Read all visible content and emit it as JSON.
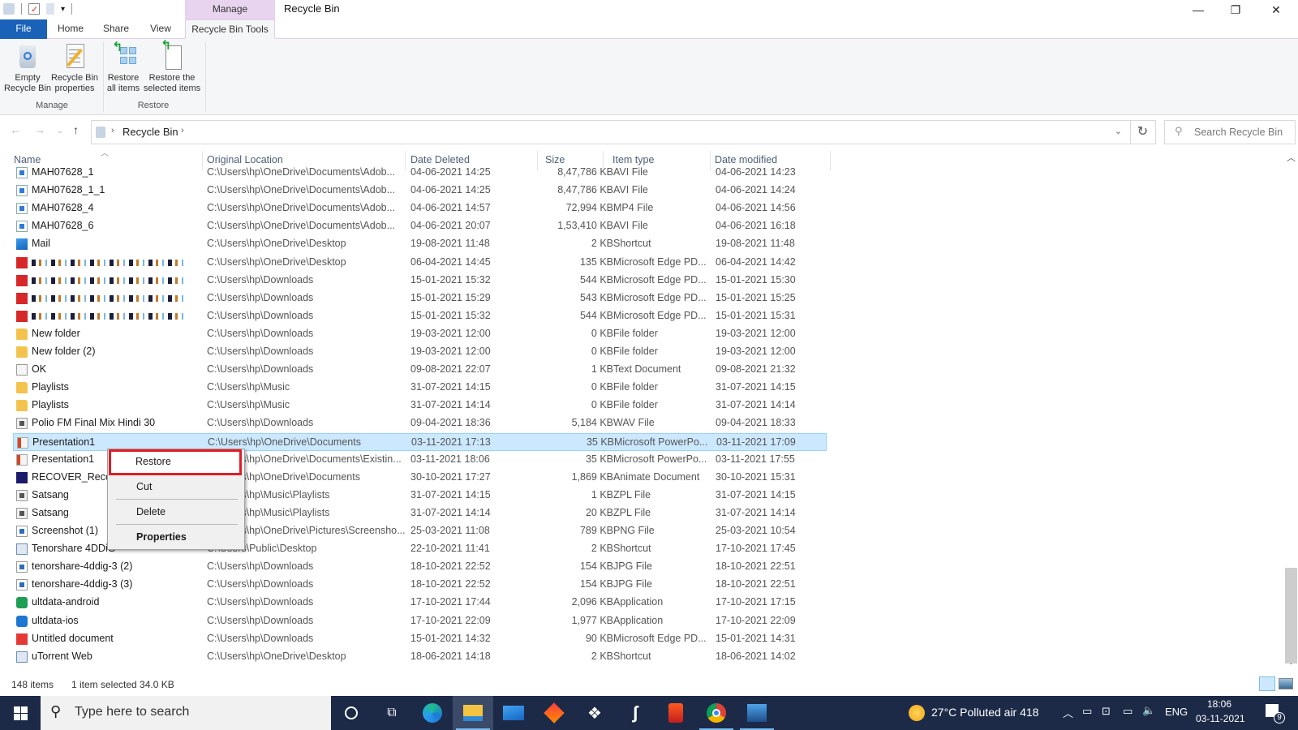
{
  "window": {
    "title": "Recycle Bin",
    "contextual_tab_group": "Manage",
    "controls": [
      "minimize",
      "maximize",
      "close"
    ]
  },
  "ribbon": {
    "tabs": [
      {
        "label": "File"
      },
      {
        "label": "Home"
      },
      {
        "label": "Share"
      },
      {
        "label": "View"
      },
      {
        "label": "Recycle Bin Tools"
      }
    ],
    "active_tab": "Recycle Bin Tools",
    "groups": [
      {
        "label": "Manage",
        "buttons": [
          {
            "line1": "Empty",
            "line2": "Recycle Bin",
            "icon": "recycle-bin-icon"
          },
          {
            "line1": "Recycle Bin",
            "line2": "properties",
            "icon": "properties-icon"
          }
        ]
      },
      {
        "label": "Restore",
        "buttons": [
          {
            "line1": "Restore",
            "line2": "all items",
            "icon": "restore-all-icon"
          },
          {
            "line1": "Restore the",
            "line2": "selected items",
            "icon": "restore-selected-icon"
          }
        ]
      }
    ]
  },
  "address": {
    "breadcrumb": [
      "Recycle Bin"
    ],
    "search_placeholder": "Search Recycle Bin"
  },
  "columns": [
    "Name",
    "Original Location",
    "Date Deleted",
    "Size",
    "Item type",
    "Date modified"
  ],
  "files": [
    {
      "name": "MAH07628_1",
      "loc": "C:\\Users\\hp\\OneDrive\\Documents\\Adob...",
      "deleted": "04-06-2021 14:25",
      "size": "8,47,786 KB",
      "type": "AVI File",
      "modified": "04-06-2021 14:23",
      "icon": "video"
    },
    {
      "name": "MAH07628_1_1",
      "loc": "C:\\Users\\hp\\OneDrive\\Documents\\Adob...",
      "deleted": "04-06-2021 14:25",
      "size": "8,47,786 KB",
      "type": "AVI File",
      "modified": "04-06-2021 14:24",
      "icon": "video"
    },
    {
      "name": "MAH07628_4",
      "loc": "C:\\Users\\hp\\OneDrive\\Documents\\Adob...",
      "deleted": "04-06-2021 14:57",
      "size": "72,994 KB",
      "type": "MP4 File",
      "modified": "04-06-2021 14:56",
      "icon": "video"
    },
    {
      "name": "MAH07628_6",
      "loc": "C:\\Users\\hp\\OneDrive\\Documents\\Adob...",
      "deleted": "04-06-2021 20:07",
      "size": "1,53,410 KB",
      "type": "AVI File",
      "modified": "04-06-2021 16:18",
      "icon": "video"
    },
    {
      "name": "Mail",
      "loc": "C:\\Users\\hp\\OneDrive\\Desktop",
      "deleted": "19-08-2021 11:48",
      "size": "2 KB",
      "type": "Shortcut",
      "modified": "19-08-2021 11:48",
      "icon": "mail"
    },
    {
      "name": "",
      "loc": "C:\\Users\\hp\\OneDrive\\Desktop",
      "deleted": "06-04-2021 14:45",
      "size": "135 KB",
      "type": "Microsoft Edge PD...",
      "modified": "06-04-2021 14:42",
      "icon": "pdf",
      "redacted": true
    },
    {
      "name": "",
      "loc": "C:\\Users\\hp\\Downloads",
      "deleted": "15-01-2021 15:32",
      "size": "544 KB",
      "type": "Microsoft Edge PD...",
      "modified": "15-01-2021 15:30",
      "icon": "pdf",
      "redacted": true
    },
    {
      "name": "",
      "loc": "C:\\Users\\hp\\Downloads",
      "deleted": "15-01-2021 15:29",
      "size": "543 KB",
      "type": "Microsoft Edge PD...",
      "modified": "15-01-2021 15:25",
      "icon": "pdf",
      "redacted": true
    },
    {
      "name": "",
      "loc": "C:\\Users\\hp\\Downloads",
      "deleted": "15-01-2021 15:32",
      "size": "544 KB",
      "type": "Microsoft Edge PD...",
      "modified": "15-01-2021 15:31",
      "icon": "pdf",
      "redacted": true
    },
    {
      "name": "New folder",
      "loc": "C:\\Users\\hp\\Downloads",
      "deleted": "19-03-2021 12:00",
      "size": "0 KB",
      "type": "File folder",
      "modified": "19-03-2021 12:00",
      "icon": "folder"
    },
    {
      "name": "New folder (2)",
      "loc": "C:\\Users\\hp\\Downloads",
      "deleted": "19-03-2021 12:00",
      "size": "0 KB",
      "type": "File folder",
      "modified": "19-03-2021 12:00",
      "icon": "folder"
    },
    {
      "name": "OK",
      "loc": "C:\\Users\\hp\\Downloads",
      "deleted": "09-08-2021 22:07",
      "size": "1 KB",
      "type": "Text Document",
      "modified": "09-08-2021 21:32",
      "icon": "text"
    },
    {
      "name": "Playlists",
      "loc": "C:\\Users\\hp\\Music",
      "deleted": "31-07-2021 14:15",
      "size": "0 KB",
      "type": "File folder",
      "modified": "31-07-2021 14:15",
      "icon": "folder"
    },
    {
      "name": "Playlists",
      "loc": "C:\\Users\\hp\\Music",
      "deleted": "31-07-2021 14:14",
      "size": "0 KB",
      "type": "File folder",
      "modified": "31-07-2021 14:14",
      "icon": "folder"
    },
    {
      "name": "Polio FM Final Mix Hindi 30",
      "loc": "C:\\Users\\hp\\Downloads",
      "deleted": "09-04-2021 18:36",
      "size": "5,184 KB",
      "type": "WAV File",
      "modified": "09-04-2021 18:33",
      "icon": "audio"
    },
    {
      "name": "Presentation1",
      "loc": "C:\\Users\\hp\\OneDrive\\Documents",
      "deleted": "03-11-2021 17:13",
      "size": "35 KB",
      "type": "Microsoft PowerPo...",
      "modified": "03-11-2021 17:09",
      "icon": "ppt",
      "selected": true
    },
    {
      "name": "Presentation1",
      "loc": "C:\\Users\\hp\\OneDrive\\Documents\\Existin...",
      "deleted": "03-11-2021 18:06",
      "size": "35 KB",
      "type": "Microsoft PowerPo...",
      "modified": "03-11-2021 17:55",
      "icon": "ppt"
    },
    {
      "name": "RECOVER_Recov",
      "loc": "C:\\Users\\hp\\OneDrive\\Documents",
      "deleted": "30-10-2021 17:27",
      "size": "1,869 KB",
      "type": "Animate Document",
      "modified": "30-10-2021 15:31",
      "icon": "animate"
    },
    {
      "name": "Satsang",
      "loc": "C:\\Users\\hp\\Music\\Playlists",
      "deleted": "31-07-2021 14:15",
      "size": "1 KB",
      "type": "ZPL File",
      "modified": "31-07-2021 14:15",
      "icon": "audio"
    },
    {
      "name": "Satsang",
      "loc": "C:\\Users\\hp\\Music\\Playlists",
      "deleted": "31-07-2021 14:14",
      "size": "20 KB",
      "type": "ZPL File",
      "modified": "31-07-2021 14:14",
      "icon": "audio"
    },
    {
      "name": "Screenshot (1)",
      "loc": "C:\\Users\\hp\\OneDrive\\Pictures\\Screensho...",
      "deleted": "25-03-2021 11:08",
      "size": "789 KB",
      "type": "PNG File",
      "modified": "25-03-2021 10:54",
      "icon": "image"
    },
    {
      "name": "Tenorshare 4DDiG",
      "loc": "C:\\Users\\Public\\Desktop",
      "deleted": "22-10-2021 11:41",
      "size": "2 KB",
      "type": "Shortcut",
      "modified": "17-10-2021 17:45",
      "icon": "shortcut"
    },
    {
      "name": "tenorshare-4ddig-3 (2)",
      "loc": "C:\\Users\\hp\\Downloads",
      "deleted": "18-10-2021 22:52",
      "size": "154 KB",
      "type": "JPG File",
      "modified": "18-10-2021 22:51",
      "icon": "image"
    },
    {
      "name": "tenorshare-4ddig-3 (3)",
      "loc": "C:\\Users\\hp\\Downloads",
      "deleted": "18-10-2021 22:52",
      "size": "154 KB",
      "type": "JPG File",
      "modified": "18-10-2021 22:51",
      "icon": "image"
    },
    {
      "name": "ultdata-android",
      "loc": "C:\\Users\\hp\\Downloads",
      "deleted": "17-10-2021 17:44",
      "size": "2,096 KB",
      "type": "Application",
      "modified": "17-10-2021 17:15",
      "icon": "app-green"
    },
    {
      "name": "ultdata-ios",
      "loc": "C:\\Users\\hp\\Downloads",
      "deleted": "17-10-2021 22:09",
      "size": "1,977 KB",
      "type": "Application",
      "modified": "17-10-2021 22:09",
      "icon": "app-blue"
    },
    {
      "name": "Untitled document",
      "loc": "C:\\Users\\hp\\Downloads",
      "deleted": "15-01-2021 14:32",
      "size": "90 KB",
      "type": "Microsoft Edge PD...",
      "modified": "15-01-2021 14:31",
      "icon": "pdf-red"
    },
    {
      "name": "uTorrent Web",
      "loc": "C:\\Users\\hp\\OneDrive\\Desktop",
      "deleted": "18-06-2021 14:18",
      "size": "2 KB",
      "type": "Shortcut",
      "modified": "18-06-2021 14:02",
      "icon": "shortcut"
    }
  ],
  "context_menu": {
    "items": [
      "Restore",
      "Cut",
      "Delete",
      "Properties"
    ],
    "highlighted": "Restore",
    "bold": "Properties"
  },
  "status": {
    "count": "148 items",
    "selection": "1 item selected  34.0 KB"
  },
  "taskbar": {
    "search_placeholder": "Type here to search",
    "apps": [
      "cortana",
      "task-view",
      "edge",
      "file-explorer",
      "mail",
      "app-red-diamond",
      "dropbox",
      "app-bolt",
      "office",
      "chrome",
      "photos"
    ],
    "active_app": "file-explorer",
    "weather": "27°C  Polluted air 418",
    "language": "ENG",
    "time": "18:06",
    "date": "03-11-2021",
    "notifications": "9"
  },
  "colors": {
    "accent": "#1a62b8",
    "selection": "#cce8ff",
    "contextual_tab": "#e9d4f0",
    "highlight_box": "#e21c24",
    "taskbar": "#1c2a48"
  }
}
